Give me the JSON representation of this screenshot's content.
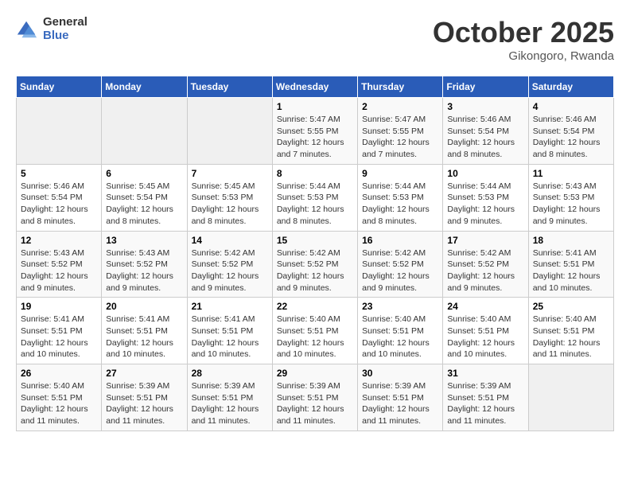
{
  "header": {
    "logo_general": "General",
    "logo_blue": "Blue",
    "month": "October 2025",
    "location": "Gikongoro, Rwanda"
  },
  "weekdays": [
    "Sunday",
    "Monday",
    "Tuesday",
    "Wednesday",
    "Thursday",
    "Friday",
    "Saturday"
  ],
  "weeks": [
    [
      {
        "day": "",
        "info": ""
      },
      {
        "day": "",
        "info": ""
      },
      {
        "day": "",
        "info": ""
      },
      {
        "day": "1",
        "sunrise": "5:47 AM",
        "sunset": "5:55 PM",
        "daylight": "12 hours and 7 minutes."
      },
      {
        "day": "2",
        "sunrise": "5:47 AM",
        "sunset": "5:55 PM",
        "daylight": "12 hours and 7 minutes."
      },
      {
        "day": "3",
        "sunrise": "5:46 AM",
        "sunset": "5:54 PM",
        "daylight": "12 hours and 8 minutes."
      },
      {
        "day": "4",
        "sunrise": "5:46 AM",
        "sunset": "5:54 PM",
        "daylight": "12 hours and 8 minutes."
      }
    ],
    [
      {
        "day": "5",
        "sunrise": "5:46 AM",
        "sunset": "5:54 PM",
        "daylight": "12 hours and 8 minutes."
      },
      {
        "day": "6",
        "sunrise": "5:45 AM",
        "sunset": "5:54 PM",
        "daylight": "12 hours and 8 minutes."
      },
      {
        "day": "7",
        "sunrise": "5:45 AM",
        "sunset": "5:53 PM",
        "daylight": "12 hours and 8 minutes."
      },
      {
        "day": "8",
        "sunrise": "5:44 AM",
        "sunset": "5:53 PM",
        "daylight": "12 hours and 8 minutes."
      },
      {
        "day": "9",
        "sunrise": "5:44 AM",
        "sunset": "5:53 PM",
        "daylight": "12 hours and 8 minutes."
      },
      {
        "day": "10",
        "sunrise": "5:44 AM",
        "sunset": "5:53 PM",
        "daylight": "12 hours and 9 minutes."
      },
      {
        "day": "11",
        "sunrise": "5:43 AM",
        "sunset": "5:53 PM",
        "daylight": "12 hours and 9 minutes."
      }
    ],
    [
      {
        "day": "12",
        "sunrise": "5:43 AM",
        "sunset": "5:52 PM",
        "daylight": "12 hours and 9 minutes."
      },
      {
        "day": "13",
        "sunrise": "5:43 AM",
        "sunset": "5:52 PM",
        "daylight": "12 hours and 9 minutes."
      },
      {
        "day": "14",
        "sunrise": "5:42 AM",
        "sunset": "5:52 PM",
        "daylight": "12 hours and 9 minutes."
      },
      {
        "day": "15",
        "sunrise": "5:42 AM",
        "sunset": "5:52 PM",
        "daylight": "12 hours and 9 minutes."
      },
      {
        "day": "16",
        "sunrise": "5:42 AM",
        "sunset": "5:52 PM",
        "daylight": "12 hours and 9 minutes."
      },
      {
        "day": "17",
        "sunrise": "5:42 AM",
        "sunset": "5:52 PM",
        "daylight": "12 hours and 9 minutes."
      },
      {
        "day": "18",
        "sunrise": "5:41 AM",
        "sunset": "5:51 PM",
        "daylight": "12 hours and 10 minutes."
      }
    ],
    [
      {
        "day": "19",
        "sunrise": "5:41 AM",
        "sunset": "5:51 PM",
        "daylight": "12 hours and 10 minutes."
      },
      {
        "day": "20",
        "sunrise": "5:41 AM",
        "sunset": "5:51 PM",
        "daylight": "12 hours and 10 minutes."
      },
      {
        "day": "21",
        "sunrise": "5:41 AM",
        "sunset": "5:51 PM",
        "daylight": "12 hours and 10 minutes."
      },
      {
        "day": "22",
        "sunrise": "5:40 AM",
        "sunset": "5:51 PM",
        "daylight": "12 hours and 10 minutes."
      },
      {
        "day": "23",
        "sunrise": "5:40 AM",
        "sunset": "5:51 PM",
        "daylight": "12 hours and 10 minutes."
      },
      {
        "day": "24",
        "sunrise": "5:40 AM",
        "sunset": "5:51 PM",
        "daylight": "12 hours and 10 minutes."
      },
      {
        "day": "25",
        "sunrise": "5:40 AM",
        "sunset": "5:51 PM",
        "daylight": "12 hours and 11 minutes."
      }
    ],
    [
      {
        "day": "26",
        "sunrise": "5:40 AM",
        "sunset": "5:51 PM",
        "daylight": "12 hours and 11 minutes."
      },
      {
        "day": "27",
        "sunrise": "5:39 AM",
        "sunset": "5:51 PM",
        "daylight": "12 hours and 11 minutes."
      },
      {
        "day": "28",
        "sunrise": "5:39 AM",
        "sunset": "5:51 PM",
        "daylight": "12 hours and 11 minutes."
      },
      {
        "day": "29",
        "sunrise": "5:39 AM",
        "sunset": "5:51 PM",
        "daylight": "12 hours and 11 minutes."
      },
      {
        "day": "30",
        "sunrise": "5:39 AM",
        "sunset": "5:51 PM",
        "daylight": "12 hours and 11 minutes."
      },
      {
        "day": "31",
        "sunrise": "5:39 AM",
        "sunset": "5:51 PM",
        "daylight": "12 hours and 11 minutes."
      },
      {
        "day": "",
        "info": ""
      }
    ]
  ]
}
